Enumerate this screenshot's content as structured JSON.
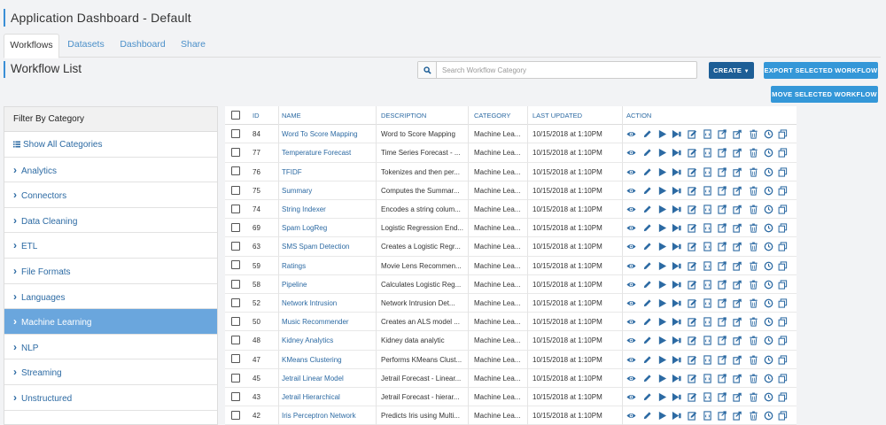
{
  "app": {
    "title": "Application Dashboard - Default"
  },
  "tabs": [
    {
      "label": "Workflows",
      "active": true
    },
    {
      "label": "Datasets",
      "active": false
    },
    {
      "label": "Dashboard",
      "active": false
    },
    {
      "label": "Share",
      "active": false
    }
  ],
  "section": {
    "title": "Workflow List"
  },
  "search": {
    "placeholder": "Search Workflow Category",
    "value": ""
  },
  "buttons": {
    "create": "CREATE",
    "export": "EXPORT SELECTED WORKFLOW",
    "move": "MOVE SELECTED WORKFLOW"
  },
  "sidebar": {
    "header": "Filter By Category",
    "items": [
      {
        "label": "Show All Categories",
        "icon": "list-icon",
        "active": false
      },
      {
        "label": "Analytics",
        "icon": "chevron-right-icon",
        "active": false
      },
      {
        "label": "Connectors",
        "icon": "chevron-right-icon",
        "active": false
      },
      {
        "label": "Data Cleaning",
        "icon": "chevron-right-icon",
        "active": false
      },
      {
        "label": "ETL",
        "icon": "chevron-right-icon",
        "active": false
      },
      {
        "label": "File Formats",
        "icon": "chevron-right-icon",
        "active": false
      },
      {
        "label": "Languages",
        "icon": "chevron-right-icon",
        "active": false
      },
      {
        "label": "Machine Learning",
        "icon": "chevron-right-icon",
        "active": true
      },
      {
        "label": "NLP",
        "icon": "chevron-right-icon",
        "active": false
      },
      {
        "label": "Streaming",
        "icon": "chevron-right-icon",
        "active": false
      },
      {
        "label": "Unstructured",
        "icon": "chevron-right-icon",
        "active": false
      }
    ]
  },
  "table": {
    "columns": [
      "ID",
      "NAME",
      "DESCRIPTION",
      "CATEGORY",
      "LAST UPDATED",
      "ACTION"
    ],
    "rows": [
      {
        "id": "84",
        "name": "Word To Score Mapping",
        "description": "Word to Score Mapping",
        "category": "Machine Lea...",
        "updated": "10/15/2018 at 1:10PM"
      },
      {
        "id": "77",
        "name": "Temperature Forecast",
        "description": "Time Series Forecast - ...",
        "category": "Machine Lea...",
        "updated": "10/15/2018 at 1:10PM"
      },
      {
        "id": "76",
        "name": "TFIDF",
        "description": "Tokenizes and then per...",
        "category": "Machine Lea...",
        "updated": "10/15/2018 at 1:10PM"
      },
      {
        "id": "75",
        "name": "Summary",
        "description": "Computes the Summar...",
        "category": "Machine Lea...",
        "updated": "10/15/2018 at 1:10PM"
      },
      {
        "id": "74",
        "name": "String Indexer",
        "description": "Encodes a string colum...",
        "category": "Machine Lea...",
        "updated": "10/15/2018 at 1:10PM"
      },
      {
        "id": "69",
        "name": "Spam LogReg",
        "description": "Logistic Regression End...",
        "category": "Machine Lea...",
        "updated": "10/15/2018 at 1:10PM"
      },
      {
        "id": "63",
        "name": "SMS Spam Detection",
        "description": "Creates a Logistic Regr...",
        "category": "Machine Lea...",
        "updated": "10/15/2018 at 1:10PM"
      },
      {
        "id": "59",
        "name": "Ratings",
        "description": "Movie Lens Recommen...",
        "category": "Machine Lea...",
        "updated": "10/15/2018 at 1:10PM"
      },
      {
        "id": "58",
        "name": "Pipeline",
        "description": "Calculates Logistic Reg...",
        "category": "Machine Lea...",
        "updated": "10/15/2018 at 1:10PM"
      },
      {
        "id": "52",
        "name": "Network Intrusion",
        "description": "Network Intrusion Det...",
        "category": "Machine Lea...",
        "updated": "10/15/2018 at 1:10PM"
      },
      {
        "id": "50",
        "name": "Music Recommender",
        "description": "Creates an ALS model ...",
        "category": "Machine Lea...",
        "updated": "10/15/2018 at 1:10PM"
      },
      {
        "id": "48",
        "name": "Kidney Analytics",
        "description": "Kidney data analytic",
        "category": "Machine Lea...",
        "updated": "10/15/2018 at 1:10PM"
      },
      {
        "id": "47",
        "name": "KMeans Clustering",
        "description": "Performs KMeans Clust...",
        "category": "Machine Lea...",
        "updated": "10/15/2018 at 1:10PM"
      },
      {
        "id": "45",
        "name": "Jetrail Linear Model",
        "description": "Jetrail Forecast - Linear...",
        "category": "Machine Lea...",
        "updated": "10/15/2018 at 1:10PM"
      },
      {
        "id": "43",
        "name": "Jetrail Hierarchical",
        "description": "Jetrail Forecast - hierar...",
        "category": "Machine Lea...",
        "updated": "10/15/2018 at 1:10PM"
      },
      {
        "id": "42",
        "name": "Iris Perceptron Network",
        "description": "Predicts Iris using Multi...",
        "category": "Machine Lea...",
        "updated": "10/15/2018 at 1:10PM"
      }
    ],
    "action_icons": [
      "view-icon",
      "edit-icon",
      "run-icon",
      "run-with-options-icon",
      "edit-details-icon",
      "view-code-icon",
      "move-icon",
      "export-icon",
      "delete-icon",
      "history-icon",
      "copy-icon"
    ]
  },
  "colors": {
    "accent": "#3497d8",
    "create_button": "#1d5e96",
    "link": "#2c6aa3",
    "active_sidebar": "#6aa6dd",
    "icon": "#2c6aa3"
  }
}
